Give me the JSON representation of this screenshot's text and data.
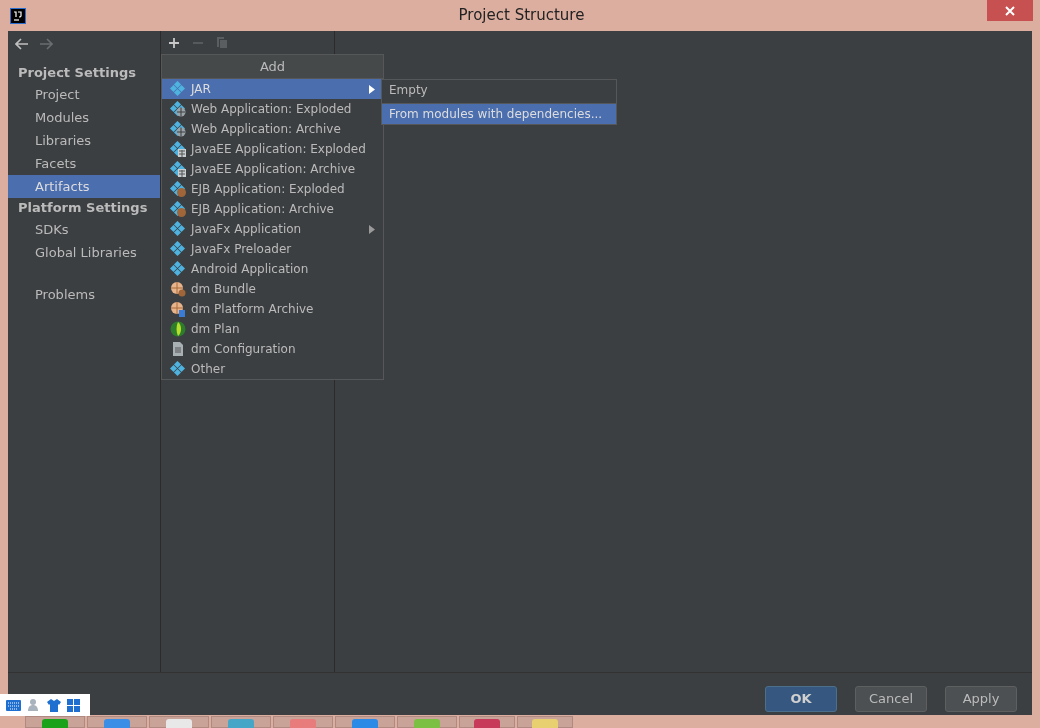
{
  "window": {
    "title": "Project Structure"
  },
  "sidebar": {
    "sections": [
      {
        "title": "Project Settings",
        "items": [
          {
            "label": "Project",
            "selected": false
          },
          {
            "label": "Modules",
            "selected": false
          },
          {
            "label": "Libraries",
            "selected": false
          },
          {
            "label": "Facets",
            "selected": false
          },
          {
            "label": "Artifacts",
            "selected": true
          }
        ]
      },
      {
        "title": "Platform Settings",
        "items": [
          {
            "label": "SDKs",
            "selected": false
          },
          {
            "label": "Global Libraries",
            "selected": false
          }
        ]
      }
    ],
    "problems": "Problems"
  },
  "toolbar": {
    "remove_disabled": true,
    "copy_disabled": true
  },
  "add_popup": {
    "title": "Add",
    "items": [
      {
        "label": "JAR",
        "kind": "diamond",
        "submenu": true,
        "selected": true
      },
      {
        "label": "Web Application: Exploded",
        "kind": "web",
        "submenu": false,
        "selected": false
      },
      {
        "label": "Web Application: Archive",
        "kind": "web",
        "submenu": false,
        "selected": false
      },
      {
        "label": "JavaEE Application: Exploded",
        "kind": "javaee",
        "submenu": false,
        "selected": false
      },
      {
        "label": "JavaEE Application: Archive",
        "kind": "javaee",
        "submenu": false,
        "selected": false
      },
      {
        "label": "EJB Application: Exploded",
        "kind": "ejb",
        "submenu": false,
        "selected": false
      },
      {
        "label": "EJB Application: Archive",
        "kind": "ejb",
        "submenu": false,
        "selected": false
      },
      {
        "label": "JavaFx Application",
        "kind": "diamond",
        "submenu": true,
        "selected": false
      },
      {
        "label": "JavaFx Preloader",
        "kind": "diamond",
        "submenu": false,
        "selected": false
      },
      {
        "label": "Android Application",
        "kind": "diamond",
        "submenu": false,
        "selected": false
      },
      {
        "label": "dm Bundle",
        "kind": "bundle",
        "submenu": false,
        "selected": false
      },
      {
        "label": "dm Platform Archive",
        "kind": "platform",
        "submenu": false,
        "selected": false
      },
      {
        "label": "dm Plan",
        "kind": "plan",
        "submenu": false,
        "selected": false
      },
      {
        "label": "dm Configuration",
        "kind": "config",
        "submenu": false,
        "selected": false
      },
      {
        "label": "Other",
        "kind": "diamond",
        "submenu": false,
        "selected": false
      }
    ]
  },
  "submenu": {
    "items": [
      {
        "label": "Empty",
        "selected": false
      },
      {
        "label": "From modules with dependencies...",
        "selected": true
      }
    ]
  },
  "buttons": [
    {
      "label": "OK",
      "default": true
    },
    {
      "label": "Cancel",
      "default": false
    },
    {
      "label": "Apply",
      "default": false
    }
  ]
}
